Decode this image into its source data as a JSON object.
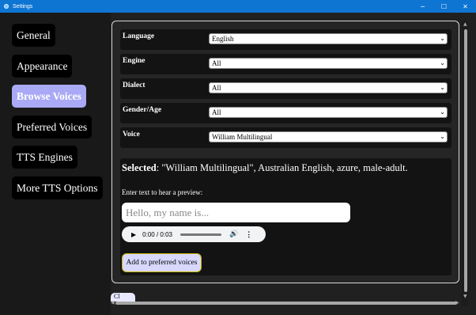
{
  "window": {
    "title": "Settings",
    "controls": [
      "─",
      "☐",
      "✕"
    ]
  },
  "sidebar": {
    "items": [
      {
        "label": "General",
        "active": false
      },
      {
        "label": "Appearance",
        "active": false
      },
      {
        "label": "Browse Voices",
        "active": true
      },
      {
        "label": "Preferred Voices",
        "active": false
      },
      {
        "label": "TTS Engines",
        "active": false
      },
      {
        "label": "More TTS Options",
        "active": false
      }
    ]
  },
  "filters": {
    "language": {
      "label": "Language",
      "value": "English"
    },
    "engine": {
      "label": "Engine",
      "value": "All"
    },
    "dialect": {
      "label": "Dialect",
      "value": "All"
    },
    "gender_age": {
      "label": "Gender/Age",
      "value": "All"
    },
    "voice": {
      "label": "Voice",
      "value": "William Multilingual"
    }
  },
  "details": {
    "selected_label": "Selected",
    "selected_value": ": \"William Multilingual\", Australian English, azure, male-adult.",
    "preview_prompt": "Enter text to hear a preview:",
    "preview_placeholder": "Hello, my name is...",
    "audio_time": "0:00 / 0:03",
    "add_button": "Add to preferred voices"
  },
  "footer": {
    "partial_button": "Cl"
  },
  "colors": {
    "titlebar": "#0f75d2",
    "active_nav": "#a9a9f6",
    "panel_bg": "#252525",
    "add_button_bg": "#d8d8ff",
    "add_button_border": "#c9b400"
  }
}
